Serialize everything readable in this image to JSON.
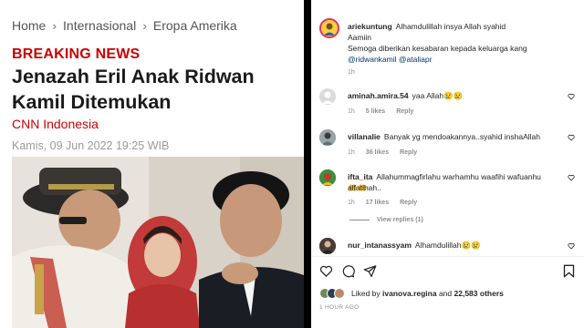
{
  "article": {
    "breadcrumb": [
      "Home",
      "Internasional",
      "Eropa Amerika"
    ],
    "breaking": "BREAKING NEWS",
    "headline": "Jenazah Eril Anak Ridwan Kamil Ditemukan",
    "source": "CNN Indonesia",
    "date": "Kamis, 09 Jun 2022 19:25 WIB"
  },
  "instagram": {
    "caption": {
      "username": "ariekuntung",
      "line1": "Alhamdulillah insya Allah syahid",
      "line2": "Aamiin",
      "line3": "Semoga diberikan kesabaran kepada keluarga kang",
      "mention1": "@ridwankamil",
      "mention2": "@ataliapr",
      "time": "1h"
    },
    "comments": [
      {
        "username": "aminah.amira.54",
        "text": "yaa Allah😢😢",
        "time": "1h",
        "likes": "5 likes",
        "reply": "Reply"
      },
      {
        "username": "villanalie",
        "text": "Banyak yg mendoakannya..syahid inshaAllah",
        "time": "1h",
        "likes": "36 likes",
        "reply": "Reply"
      },
      {
        "username": "ifta_ita",
        "text": "Allahummagfirlahu warhamhu waafihi wafuanhu 🤲🤲",
        "text2": "alfatihah..",
        "time": "1h",
        "likes": "17 likes",
        "reply": "Reply"
      },
      {
        "username": "nur_intanassyam",
        "text": "Alhamdulillah😢😢"
      }
    ],
    "view_replies": "View replies (1)",
    "liked_by_prefix": "Liked by",
    "liked_by_user": "ivanova.regina",
    "liked_by_and": "and",
    "liked_by_count": "22,583 others",
    "posted_ago": "1 HOUR AGO"
  },
  "colors": {
    "breaking_red": "#cc0000",
    "link_blue": "#00376b",
    "meta_gray": "#8e8e8e"
  }
}
